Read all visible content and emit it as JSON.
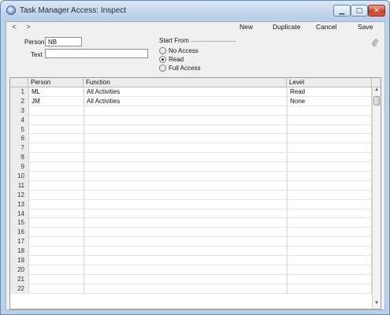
{
  "window": {
    "title": "Task Manager Access: Inspect",
    "minimize_glyph": "▁",
    "maximize_glyph": "▢",
    "close_glyph": "✕"
  },
  "toolbar": {
    "prev_glyph": "<",
    "next_glyph": ">",
    "new_label": "New",
    "duplicate_label": "Duplicate",
    "cancel_label": "Cancel",
    "save_label": "Save"
  },
  "form": {
    "person_label": "Person",
    "person_value": "NB",
    "text_label": "Text",
    "text_value": "",
    "start_from_label": "Start From",
    "options": [
      {
        "label": "No Access",
        "checked": false
      },
      {
        "label": "Read",
        "checked": true
      },
      {
        "label": "Full Access",
        "checked": false
      }
    ],
    "attach_icon": "paperclip-icon"
  },
  "grid": {
    "headers": {
      "person": "Person",
      "function": "Function",
      "level": "Level"
    },
    "rows": [
      {
        "num": "1",
        "person": "ML",
        "function": "All Activities",
        "level": "Read"
      },
      {
        "num": "2",
        "person": "JM",
        "function": "All Activities",
        "level": "None"
      },
      {
        "num": "3",
        "person": "",
        "function": "",
        "level": ""
      },
      {
        "num": "4",
        "person": "",
        "function": "",
        "level": ""
      },
      {
        "num": "5",
        "person": "",
        "function": "",
        "level": ""
      },
      {
        "num": "6",
        "person": "",
        "function": "",
        "level": ""
      },
      {
        "num": "7",
        "person": "",
        "function": "",
        "level": ""
      },
      {
        "num": "8",
        "person": "",
        "function": "",
        "level": ""
      },
      {
        "num": "9",
        "person": "",
        "function": "",
        "level": ""
      },
      {
        "num": "10",
        "person": "",
        "function": "",
        "level": ""
      },
      {
        "num": "11",
        "person": "",
        "function": "",
        "level": ""
      },
      {
        "num": "12",
        "person": "",
        "function": "",
        "level": ""
      },
      {
        "num": "13",
        "person": "",
        "function": "",
        "level": ""
      },
      {
        "num": "14",
        "person": "",
        "function": "",
        "level": ""
      },
      {
        "num": "15",
        "person": "",
        "function": "",
        "level": ""
      },
      {
        "num": "16",
        "person": "",
        "function": "",
        "level": ""
      },
      {
        "num": "17",
        "person": "",
        "function": "",
        "level": ""
      },
      {
        "num": "18",
        "person": "",
        "function": "",
        "level": ""
      },
      {
        "num": "19",
        "person": "",
        "function": "",
        "level": ""
      },
      {
        "num": "20",
        "person": "",
        "function": "",
        "level": ""
      },
      {
        "num": "21",
        "person": "",
        "function": "",
        "level": ""
      },
      {
        "num": "22",
        "person": "",
        "function": "",
        "level": ""
      }
    ],
    "scroll_up_glyph": "▲",
    "scroll_down_glyph": "▼"
  }
}
